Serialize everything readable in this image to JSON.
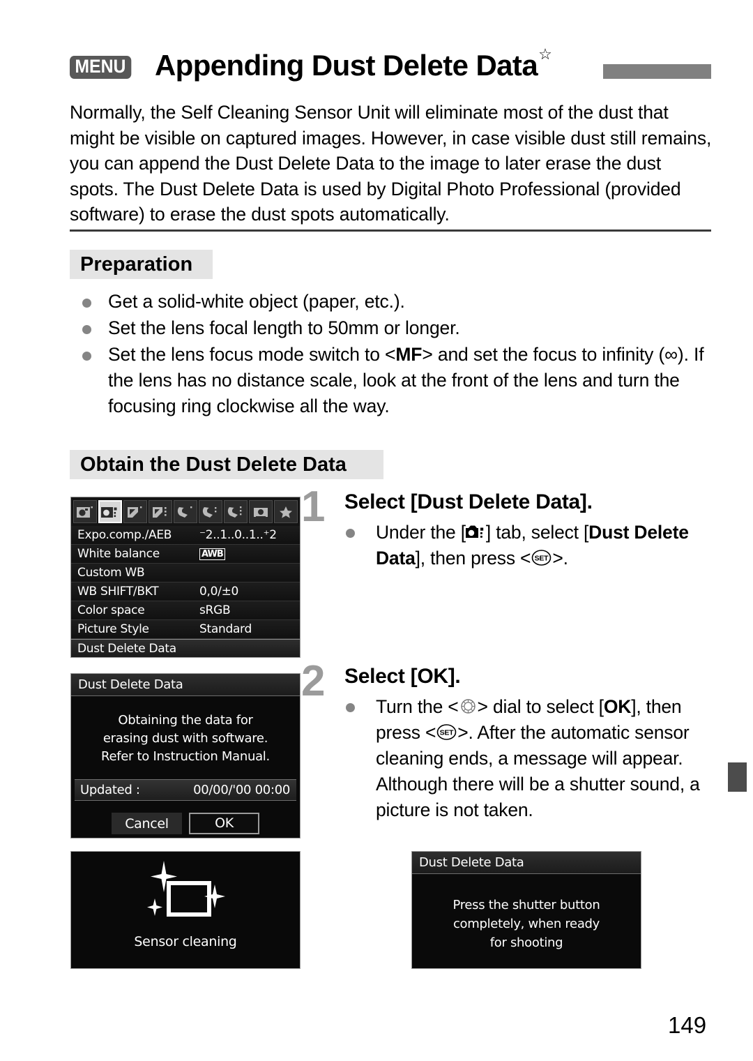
{
  "header": {
    "menu_badge": "MENU",
    "title": "Appending Dust Delete Data",
    "star": "☆"
  },
  "intro": "Normally, the Self Cleaning Sensor Unit will eliminate most of the dust that might be visible on captured images. However, in case visible dust still remains, you can append the Dust Delete Data to the image to later erase the dust spots. The Dust Delete Data is used by Digital Photo Professional (provided software) to erase the dust spots automatically.",
  "preparation": {
    "heading": "Preparation",
    "items": [
      {
        "text": "Get a solid-white object (paper, etc.)."
      },
      {
        "text": "Set the lens focal length to 50mm or longer."
      },
      {
        "pre": "Set the lens focus mode switch to <",
        "mf": "MF",
        "post": "> and set the focus to infinity (∞). If the lens has no distance scale, look at the front of the lens and turn the focusing ring clockwise all the way."
      }
    ]
  },
  "obtain": {
    "heading": "Obtain the Dust Delete Data"
  },
  "steps": [
    {
      "number": "1",
      "title": "Select [Dust Delete Data].",
      "body_pre": "Under the [",
      "body_mid": "] tab, select [",
      "body_bold1": "Dust Delete Data",
      "body_mid2": "], then press <",
      "body_post": ">."
    },
    {
      "number": "2",
      "title": "Select [OK].",
      "body_pre": "Turn the <",
      "body_mid": "> dial to select [",
      "body_bold1": "OK",
      "body_mid2": "], then press <",
      "body_post": ">. After the automatic sensor cleaning ends, a message will appear. Although there will be a shutter sound, a picture is not taken."
    }
  ],
  "lcd_menu": {
    "tabs": [
      {
        "name": "shooting-1",
        "selected": false
      },
      {
        "name": "shooting-2",
        "selected": true
      },
      {
        "name": "playback-1",
        "selected": false
      },
      {
        "name": "playback-2",
        "selected": false
      },
      {
        "name": "setup-1",
        "selected": false
      },
      {
        "name": "setup-2",
        "selected": false
      },
      {
        "name": "setup-3",
        "selected": false
      },
      {
        "name": "custom-functions",
        "selected": false
      },
      {
        "name": "my-menu",
        "selected": false
      }
    ],
    "rows": [
      {
        "label": "Expo.comp./AEB",
        "value": "⁻2..1..0..1..⁺2",
        "type": "scale",
        "highlight": false
      },
      {
        "label": "White balance",
        "value": "AWB",
        "type": "awb",
        "highlight": false
      },
      {
        "label": "Custom WB",
        "value": "",
        "type": "text",
        "highlight": false
      },
      {
        "label": "WB SHIFT/BKT",
        "value": "0,0/±0",
        "type": "text",
        "highlight": false
      },
      {
        "label": "Color space",
        "value": "sRGB",
        "type": "text",
        "highlight": false
      },
      {
        "label": "Picture Style",
        "value": "Standard",
        "type": "text",
        "highlight": false
      },
      {
        "label": "Dust Delete Data",
        "value": "",
        "type": "text",
        "highlight": true
      }
    ]
  },
  "lcd_dialog": {
    "title": "Dust Delete Data",
    "message_line1": "Obtaining the data for",
    "message_line2": "erasing dust with software.",
    "message_line3": "Refer to Instruction Manual.",
    "updated_label": "Updated :",
    "updated_value": "00/00/'00 00:00",
    "cancel_label": "Cancel",
    "ok_label": "OK"
  },
  "lcd_sensor": {
    "caption": "Sensor cleaning"
  },
  "lcd_shutter": {
    "title": "Dust Delete Data",
    "message_line1": "Press the shutter button",
    "message_line2": "completely, when ready",
    "message_line3": "for shooting"
  },
  "footer": {
    "page_number": "149"
  }
}
